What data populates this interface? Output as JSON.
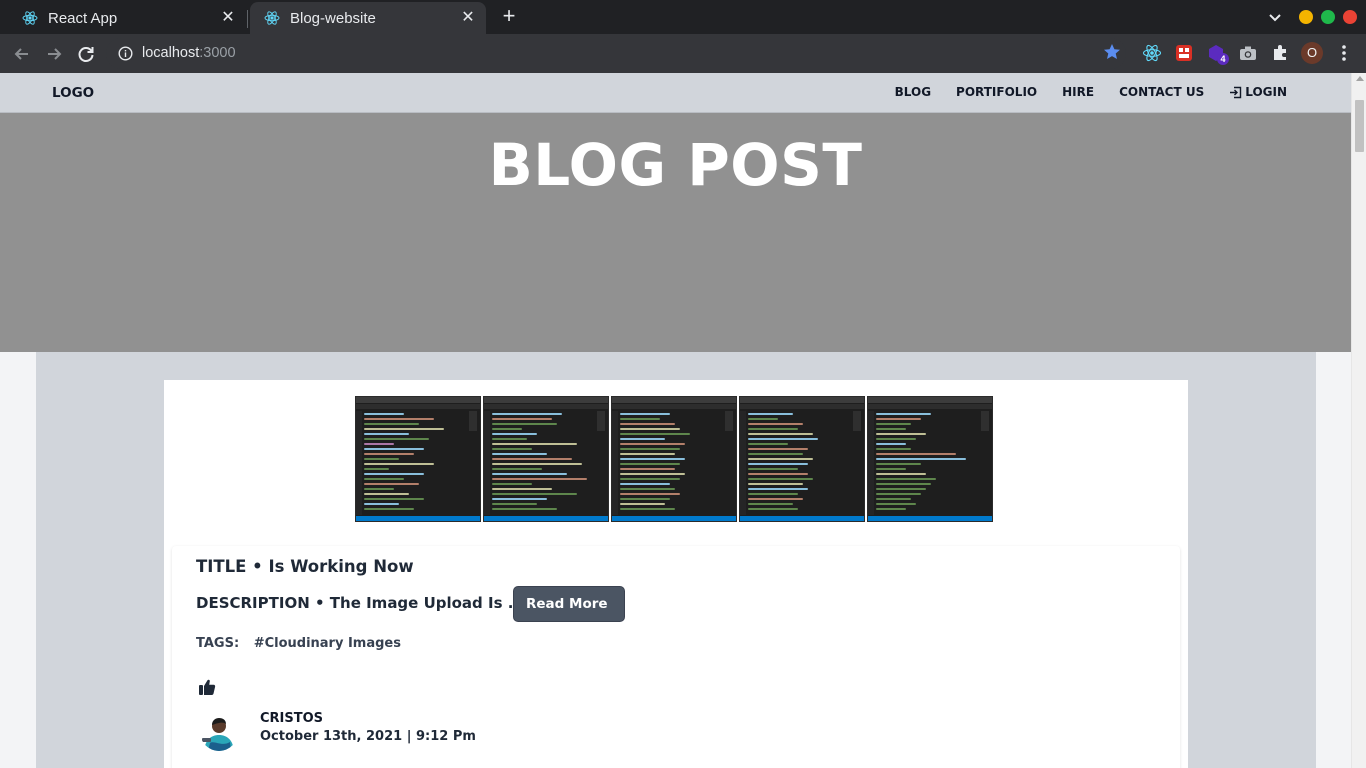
{
  "browser": {
    "tabs": [
      {
        "title": "React App",
        "active": false,
        "icon": "react-icon"
      },
      {
        "title": "Blog-website",
        "active": true,
        "icon": "react-icon"
      }
    ],
    "url_host": "localhost",
    "url_port": ":3000",
    "profile_initial": "O",
    "extension_badge": "4",
    "window_colors": {
      "minimize": "#f4b400",
      "maximize": "#1fb94b",
      "close": "#ea4335"
    }
  },
  "site": {
    "logo": "LOGO",
    "nav": {
      "blog": "BLOG",
      "portfolio": "PORTIFOLIO",
      "hire": "HIRE",
      "contact": "CONTACT US",
      "login": "LOGIN"
    },
    "hero_title": "BLOG POST"
  },
  "post": {
    "images_count_label": "5",
    "title_prefix": "TITLE •",
    "title": "Is Working Now",
    "desc_prefix": "DESCRIPTION •",
    "description": "The Image Upload Is ....",
    "read_more": "Read More",
    "tags_label": "TAGS:",
    "tag": "#Cloudinary Images",
    "author": "CRISTOS",
    "date": "October 13th, 2021 | 9:12 Pm"
  },
  "colors": {
    "nav_bg": "#d1d5db",
    "hero_bg": "#919191",
    "button_bg": "#4b5563",
    "text_dark": "#1f2937"
  }
}
